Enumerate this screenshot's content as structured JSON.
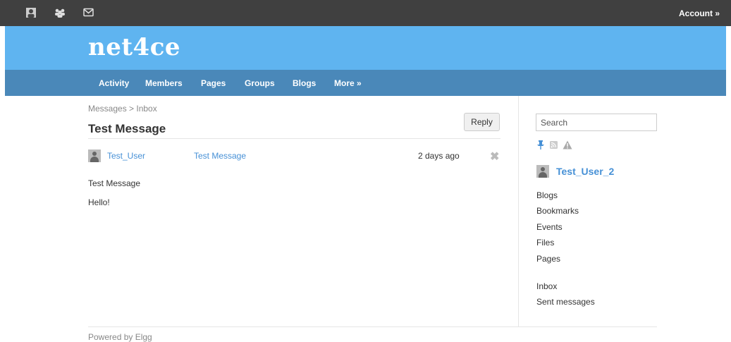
{
  "topbar": {
    "icons": [
      "profile-icon",
      "friends-icon",
      "mail-icon"
    ],
    "account_label": "Account »"
  },
  "header": {
    "site_name": "net4ce",
    "bg_color": "#5fb4f0"
  },
  "nav": {
    "bg_color": "#4a88b9",
    "items": [
      "Activity",
      "Members",
      "Pages",
      "Groups",
      "Blogs",
      "More »"
    ]
  },
  "breadcrumb": "Messages > Inbox",
  "message": {
    "title": "Test Message",
    "reply_label": "Reply",
    "sender": "Test_User",
    "subject": "Test Message",
    "time": "2 days ago",
    "body_title": "Test Message",
    "body": "Hello!"
  },
  "sidebar": {
    "search_placeholder": "Search",
    "icons": [
      "pin-icon",
      "rss-icon",
      "warning-icon"
    ],
    "owner": "Test_User_2",
    "links": [
      "Blogs",
      "Bookmarks",
      "Events",
      "Files",
      "Pages"
    ],
    "message_links": [
      "Inbox",
      "Sent messages"
    ]
  },
  "footer": {
    "text": "Powered by Elgg"
  },
  "colors": {
    "link": "#4690d6",
    "topbar": "#404040"
  }
}
